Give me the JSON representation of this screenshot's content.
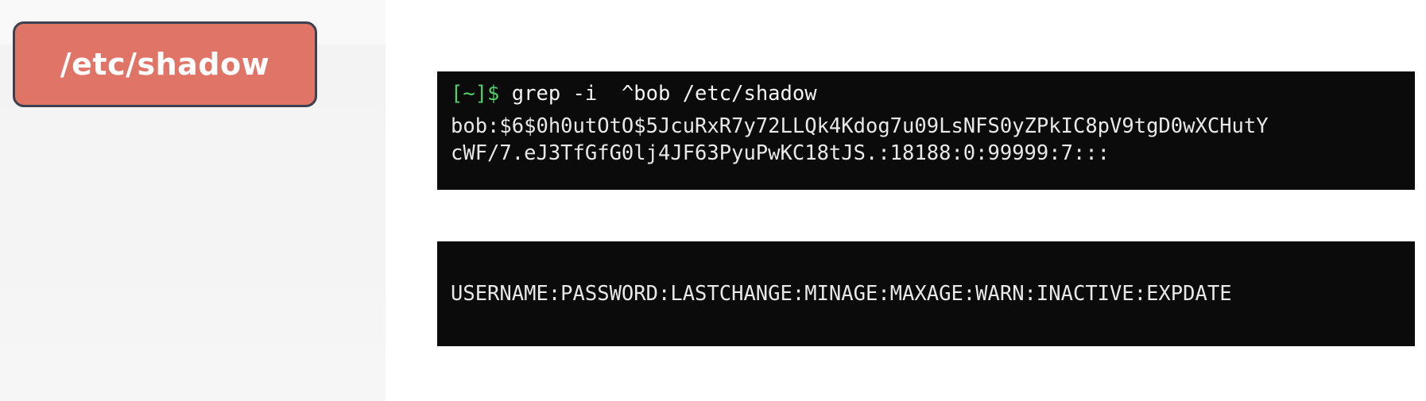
{
  "title_badge": {
    "label": "/etc/shadow"
  },
  "terminal_output": {
    "prompt": "[~]$",
    "command": " grep -i  ^bob /etc/shadow",
    "output_lines": [
      "bob:$6$0h0utOtO$5JcuRxR7y72LLQk4Kdog7u09LsNFS0yZPkIC8pV9tgD0wXCHutY",
      "cWF/7.eJ3TfGfG0lj4JF63PyuPwKC18tJS.:18188:0:99999:7:::"
    ]
  },
  "terminal_format": {
    "line": "USERNAME:PASSWORD:LASTCHANGE:MINAGE:MAXAGE:WARN:INACTIVE:EXPDATE"
  },
  "colors": {
    "badge_fill": "#e07467",
    "badge_border": "#3c4150",
    "terminal_bg": "#0b0b0b",
    "prompt_green": "#4fd06a"
  }
}
